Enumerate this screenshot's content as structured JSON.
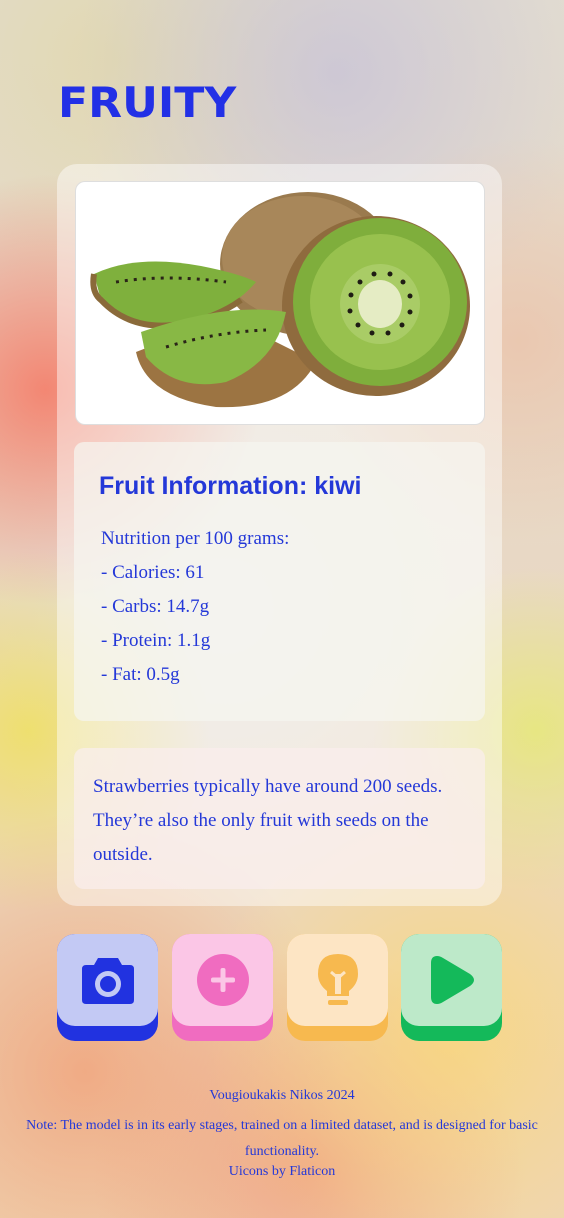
{
  "app": {
    "title": "FRUITY"
  },
  "image": {
    "alt": "kiwi"
  },
  "info": {
    "title": "Fruit Information: kiwi",
    "lines": [
      "Nutrition per 100 grams:",
      "- Calories: 61",
      "- Carbs: 14.7g",
      "- Protein: 1.1g",
      "- Fat: 0.5g"
    ]
  },
  "fact": {
    "text": "Strawberries typically have around 200 seeds. They’re also the only fruit with seeds on the outside."
  },
  "buttons": [
    {
      "icon": "camera-icon",
      "color": "#2132e0"
    },
    {
      "icon": "plus-circle-icon",
      "color": "#f06cc0"
    },
    {
      "icon": "lightbulb-icon",
      "color": "#f7b94f"
    },
    {
      "icon": "play-icon",
      "color": "#14b95a"
    }
  ],
  "footer": {
    "author": "Vougioukakis Nikos 2024",
    "note": "Note: The model is in its early stages, trained on a limited dataset, and is designed for basic functionality.",
    "credits": "Uicons by Flaticon"
  },
  "colors": {
    "accent": "#2438d8",
    "title": "#2230e6"
  }
}
